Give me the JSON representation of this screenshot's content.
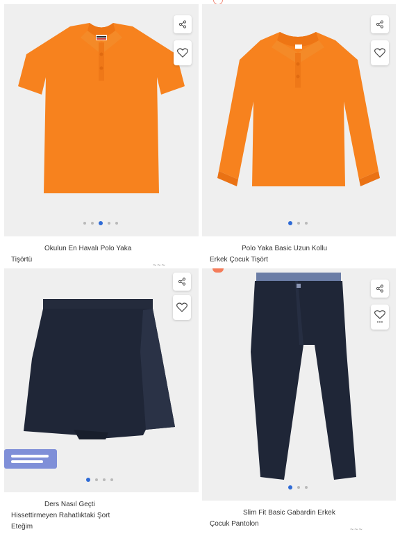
{
  "products": [
    {
      "title_line1": "Okulun En Havalı Polo Yaka",
      "title_line2": "Tişörtü",
      "price_partial": "~~~ ~~ ~",
      "image_dots": 5,
      "active_dot": 2,
      "icons": [
        "share-icon",
        "heart-icon"
      ],
      "color": "#f7821e"
    },
    {
      "title_line1": "Polo Yaka Basic Uzun Kollu",
      "title_line2": "Erkek Çocuk Tişört",
      "image_dots": 3,
      "active_dot": 0,
      "icons": [
        "share-icon",
        "heart-icon"
      ],
      "color": "#f7821e"
    },
    {
      "title_line1": "Ders Nasıl Geçti",
      "title_line2": "Hissettirmeyen Rahatlıktaki Şort",
      "title_line3": "Eteğim",
      "image_dots": 4,
      "active_dot": 0,
      "icons": [
        "share-icon",
        "heart-icon"
      ],
      "color": "#1f2637"
    },
    {
      "title_line1": "Slim Fit Basic Gabardin Erkek",
      "title_line2": "Çocuk Pantolon",
      "price_partial": "~~~ ~~ ~",
      "image_dots": 3,
      "active_dot": 0,
      "icons": [
        "share-icon",
        "heart-icon-with-more"
      ],
      "color": "#1f2637"
    }
  ]
}
